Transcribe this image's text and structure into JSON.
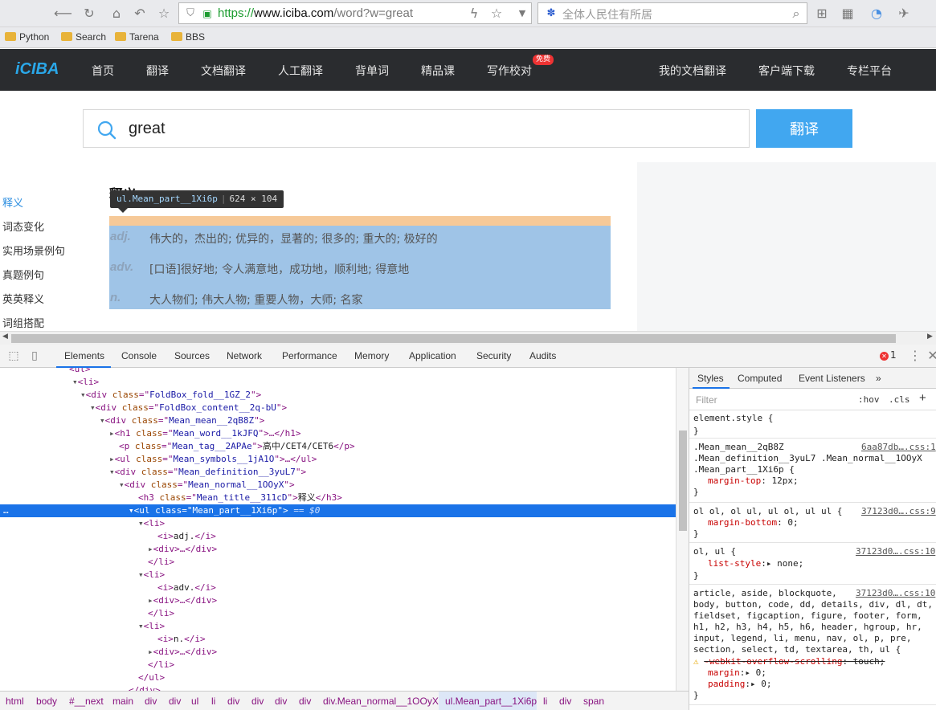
{
  "browser": {
    "url_protocol": "https://",
    "url_host": "www.iciba.com",
    "url_path": "/word?w=great",
    "search_placeholder": "全体人民住有所居",
    "bookmarks": [
      "Python",
      "Search",
      "Tarena",
      "BBS"
    ]
  },
  "site": {
    "logo": "iCIBA",
    "nav": [
      "首页",
      "翻译",
      "文档翻译",
      "人工翻译",
      "背单词",
      "精品课",
      "写作校对"
    ],
    "free_badge": "免费",
    "nav_right": [
      "我的文档翻译",
      "客户端下载",
      "专栏平台"
    ],
    "search_word": "great",
    "translate_button": "翻译",
    "left_nav": [
      "释义",
      "词态变化",
      "实用场景例句",
      "真题例句",
      "英英释义",
      "词组搭配"
    ],
    "mean_title": "释义",
    "inspect_selector": "ul.Mean_part__1Xi6p",
    "inspect_size": "624 × 104",
    "meanings": [
      {
        "pos": "adj.",
        "text": "伟大的，杰出的; 优异的，显著的; 很多的; 重大的; 极好的"
      },
      {
        "pos": "adv.",
        "text": "[口语]很好地; 令人满意地，成功地，顺利地; 得意地"
      },
      {
        "pos": "n.",
        "text": "大人物们; 伟大人物; 重要人物，大师; 名家"
      }
    ]
  },
  "devtools": {
    "tabs": [
      "Elements",
      "Console",
      "Sources",
      "Network",
      "Performance",
      "Memory",
      "Application",
      "Security",
      "Audits"
    ],
    "error_count": "1",
    "styles_tabs": [
      "Styles",
      "Computed",
      "Event Listeners"
    ],
    "filter_placeholder": "Filter",
    "filter_hov": ":hov",
    "filter_cls": ".cls",
    "breadcrumbs": [
      "html",
      "body",
      "#__next",
      "main",
      "div",
      "div",
      "ul",
      "li",
      "div",
      "div",
      "div",
      "div",
      "div.Mean_normal__1OOyX",
      "ul.Mean_part__1Xi6p",
      "li",
      "div",
      "span"
    ]
  },
  "colors": {
    "accent": "#1a73e8",
    "site_header": "#2a2c2f",
    "translate_button": "#41a7f0",
    "highlight_content": "#9fc4e7",
    "highlight_margin": "#f6c998"
  }
}
